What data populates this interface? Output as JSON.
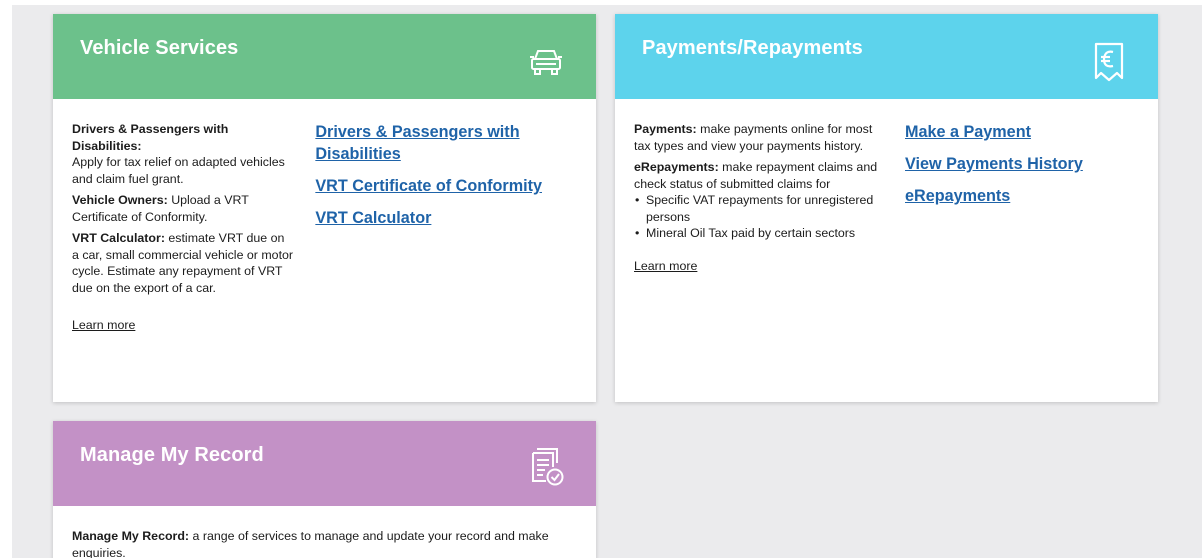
{
  "colors": {
    "vehicle_header": "#6cc18b",
    "payments_header": "#5dd3ec",
    "record_header": "#c391c6",
    "link": "#1f63a8",
    "page_background": "#ebebed"
  },
  "vehicle_services": {
    "title": "Vehicle Services",
    "icon": "car-icon",
    "items": [
      {
        "label": "Drivers & Passengers with Disabilities:",
        "text": "Apply for tax relief on adapted vehicles and claim fuel grant."
      },
      {
        "label": "Vehicle Owners:",
        "text": "Upload a VRT Certificate of Conformity."
      },
      {
        "label": "VRT Calculator:",
        "text": "estimate VRT due on a car, small commercial vehicle or motor cycle. Estimate any repayment of VRT due on the export of a car."
      }
    ],
    "learn_more": "Learn more",
    "links": [
      "Drivers & Passengers with Disabilities",
      "VRT Certificate of Conformity",
      "VRT Calculator"
    ]
  },
  "payments": {
    "title": "Payments/Repayments",
    "icon": "euro-receipt-icon",
    "items": [
      {
        "label": "Payments:",
        "text": "make payments online for most tax types and view your payments history."
      },
      {
        "label": "eRepayments:",
        "text": "make repayment claims and check status of submitted claims for"
      }
    ],
    "bullets": [
      "Specific VAT repayments for unregistered persons",
      "Mineral Oil Tax paid by certain sectors"
    ],
    "learn_more": "Learn more",
    "links": [
      "Make a Payment",
      "View Payments History",
      "eRepayments"
    ]
  },
  "manage_record": {
    "title": "Manage My Record",
    "icon": "document-check-icon",
    "label": "Manage My Record:",
    "text": "a range of services to manage and update your record and make enquiries."
  }
}
